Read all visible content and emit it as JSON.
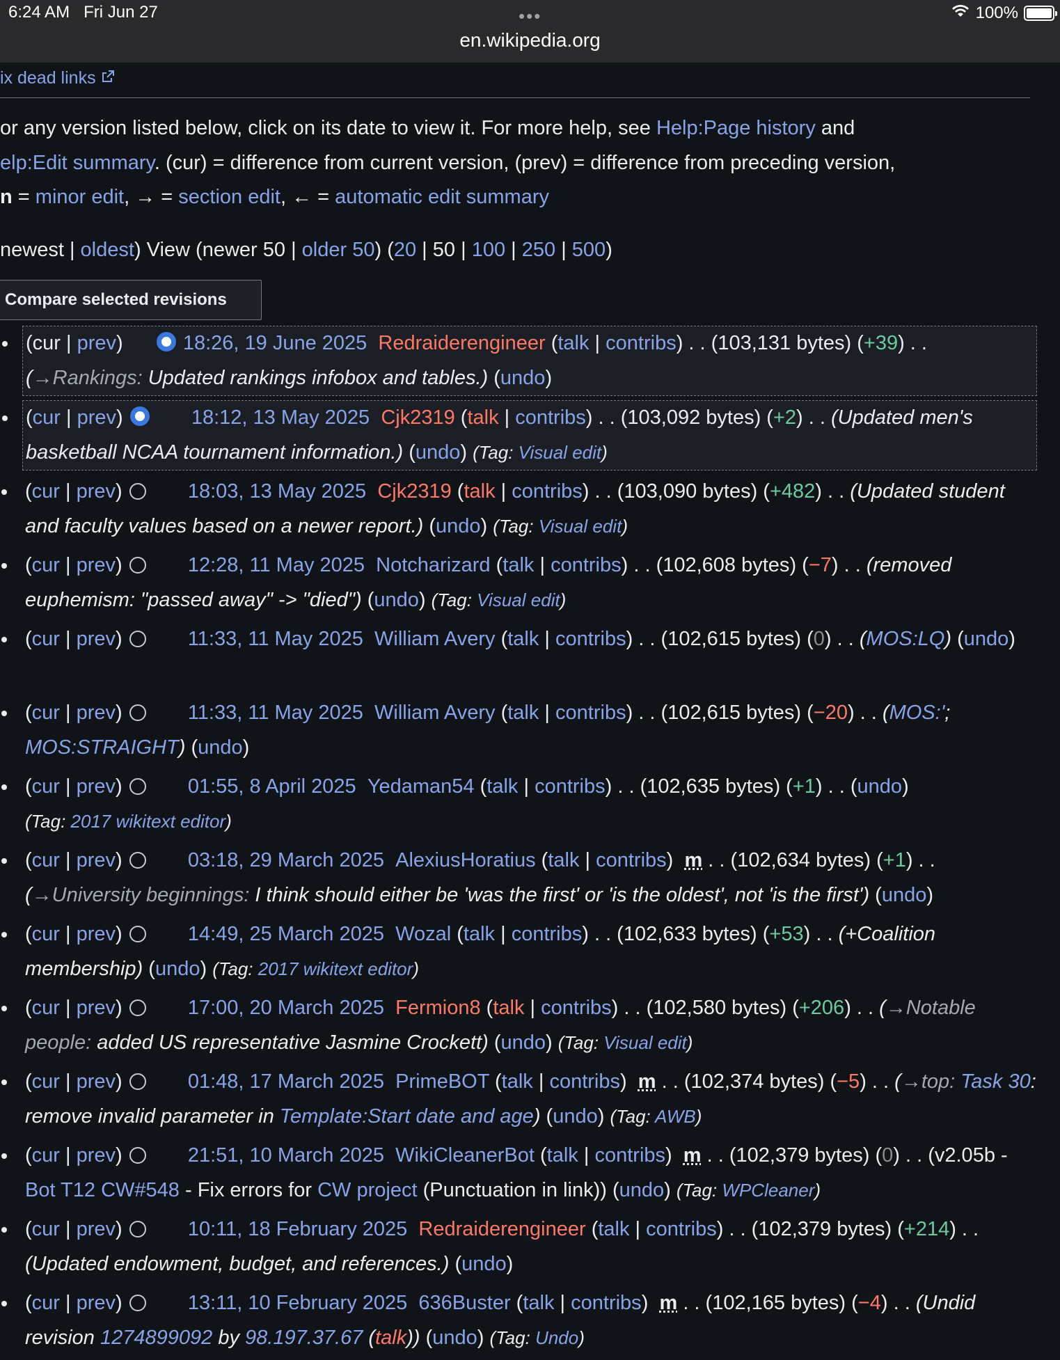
{
  "status": {
    "time": "6:24 AM",
    "date": "Fri Jun 27",
    "dots": "•••",
    "battery": "100%"
  },
  "url": "en.wikipedia.org",
  "top_link": "ix dead links",
  "help": {
    "t1": "or any version listed below, click on its date to view it. For more help, see ",
    "l1": "Help:Page history",
    "t2": " and ",
    "l2": "elp:Edit summary",
    "t3": ". (cur) = difference from current version, (prev) = difference from preceding version, ",
    "m": "n",
    "t4": " = ",
    "l3": "minor edit",
    "t5": ", → = ",
    "l4": "section edit",
    "t6": ", ← = ",
    "l5": "automatic edit summary"
  },
  "nav": {
    "newest": "newest",
    "oldest": "oldest",
    "view": " View (newer 50 | ",
    "older": "older 50",
    "n20": "20",
    "n50": "50",
    "n100": "100",
    "n250": "250",
    "n500": "500"
  },
  "compare_button": "Compare selected revisions",
  "labels": {
    "cur": "cur",
    "prev": "prev",
    "talk": "talk",
    "contribs": "contribs",
    "undo": "undo",
    "tag": "Tag",
    "minor": "m"
  },
  "revisions": [
    {
      "date": "18:26, 19 June 2025",
      "user": "Redraiderengineer",
      "bytes": "103,131 bytes",
      "diff": "+39",
      "sec": "→Rankings:",
      "summary": " Updated rankings infobox and tables."
    },
    {
      "date": "18:12, 13 May 2025",
      "user": "Cjk2319",
      "bytes": "103,092 bytes",
      "diff": "+2",
      "summary": "Updated men's basketball NCAA tournament information.",
      "tag": "Visual edit"
    },
    {
      "date": "18:03, 13 May 2025",
      "user": "Cjk2319",
      "bytes": "103,090 bytes",
      "diff": "+482",
      "summary": "Updated student and faculty values based on a newer report.",
      "tag": "Visual edit"
    },
    {
      "date": "12:28, 11 May 2025",
      "user": "Notcharizard",
      "bytes": "102,608 bytes",
      "diff": "−7",
      "summary": "removed euphemism: \"passed away\" -> \"died\"",
      "tag": "Visual edit"
    },
    {
      "date": "11:33, 11 May 2025",
      "user": "William Avery",
      "bytes": "102,615 bytes",
      "diff": "0",
      "summary_link": "MOS:LQ"
    },
    {
      "date": "11:33, 11 May 2025",
      "user": "William Avery",
      "bytes": "102,615 bytes",
      "diff": "−20",
      "summary_link": "MOS:'",
      "summary_link2": "MOS:STRAIGHT"
    },
    {
      "date": "01:55, 8 April 2025",
      "user": "Yedaman54",
      "bytes": "102,635 bytes",
      "diff": "+1",
      "tag": "2017 wikitext editor"
    },
    {
      "date": "03:18, 29 March 2025",
      "user": "AlexiusHoratius",
      "bytes": "102,634 bytes",
      "diff": "+1",
      "sec": "→University beginnings:",
      "summary": " I think should either be 'was the first' or 'is the oldest', not 'is the first'"
    },
    {
      "date": "14:49, 25 March 2025",
      "user": "Wozal",
      "bytes": "102,633 bytes",
      "diff": "+53",
      "summary": "+Coalition membership",
      "tag": "2017 wikitext editor"
    },
    {
      "date": "17:00, 20 March 2025",
      "user": "Fermion8",
      "bytes": "102,580 bytes",
      "diff": "+206",
      "sec": "→Notable people:",
      "summary": " added US representative Jasmine Crockett",
      "tag": "Visual edit"
    },
    {
      "date": "01:48, 17 March 2025",
      "user": "PrimeBOT",
      "bytes": "102,374 bytes",
      "diff": "−5",
      "sec": "→top:",
      "s_link1": "Task 30",
      "s_mid": ": remove invalid parameter in ",
      "s_link2": "Template:Start date and age",
      "tag": "AWB"
    },
    {
      "date": "21:51, 10 March 2025",
      "user": "WikiCleanerBot",
      "bytes": "102,379 bytes",
      "diff": "0",
      "s_pre": "v2.05b - ",
      "s_link1": "Bot T12 CW#548",
      "s_mid": " - Fix errors for ",
      "s_link2": "CW project",
      "s_post": " (Punctuation in link)",
      "tag": "WPCleaner"
    },
    {
      "date": "10:11, 18 February 2025",
      "user": "Redraiderengineer",
      "bytes": "102,379 bytes",
      "diff": "+214",
      "summary": "Updated endowment, budget, and references."
    },
    {
      "date": "13:11, 10 February 2025",
      "user": "636Buster",
      "bytes": "102,165 bytes",
      "diff": "−4",
      "s_pre": "Undid revision ",
      "s_link1": "1274899092",
      "s_mid": " by ",
      "s_link2": "98.197.37.67",
      "s_talk": "talk",
      "tag": "Undo"
    }
  ]
}
